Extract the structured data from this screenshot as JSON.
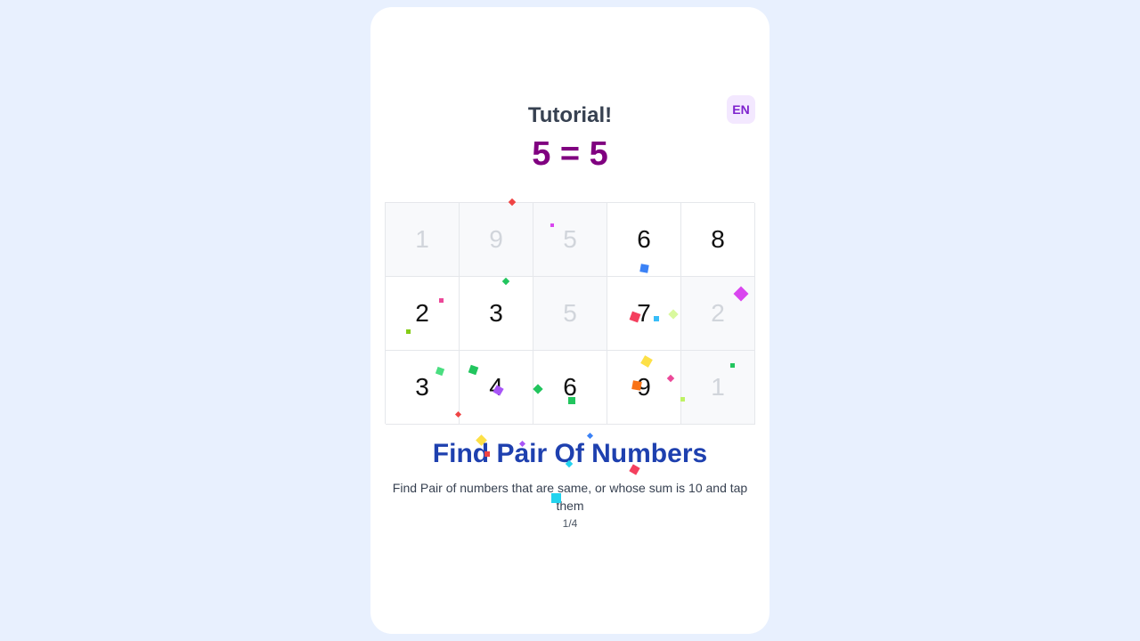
{
  "header": {
    "title": "Tutorial!",
    "language": "EN"
  },
  "equation": "5 = 5",
  "board": {
    "cells": [
      {
        "value": "1",
        "cleared": true
      },
      {
        "value": "9",
        "cleared": true
      },
      {
        "value": "5",
        "cleared": true
      },
      {
        "value": "6",
        "cleared": false
      },
      {
        "value": "8",
        "cleared": false
      },
      {
        "value": "2",
        "cleared": false
      },
      {
        "value": "3",
        "cleared": false
      },
      {
        "value": "5",
        "cleared": true
      },
      {
        "value": "7",
        "cleared": false
      },
      {
        "value": "2",
        "cleared": true
      },
      {
        "value": "3",
        "cleared": false
      },
      {
        "value": "4",
        "cleared": false
      },
      {
        "value": "6",
        "cleared": false
      },
      {
        "value": "9",
        "cleared": false
      },
      {
        "value": "1",
        "cleared": true
      }
    ]
  },
  "tutorial": {
    "heading": "Find Pair Of Numbers",
    "description": "Find Pair of numbers that are same, or whose sum is 10 and tap them",
    "page": "1/4"
  },
  "colors": {
    "background": "#e8f0fe",
    "title": "#374151",
    "equation": "#800080",
    "heading": "#1e40af",
    "language_badge_bg": "#f3e8ff",
    "language_badge_text": "#7e22ce"
  }
}
